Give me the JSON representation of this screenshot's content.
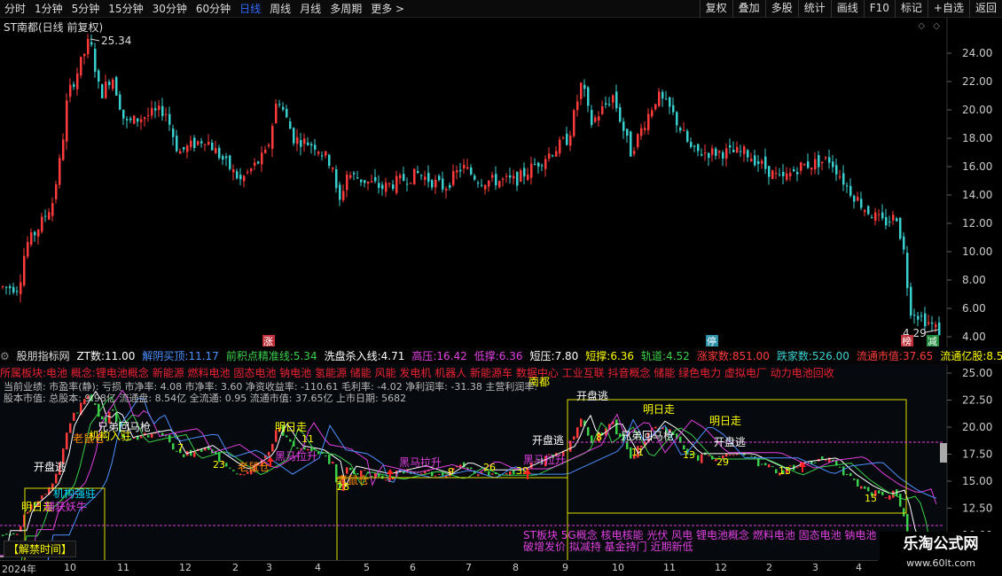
{
  "toolbar": {
    "periods": [
      "分时",
      "1分钟",
      "5分钟",
      "15分钟",
      "30分钟",
      "60分钟",
      "日线",
      "周线",
      "月线",
      "多周期",
      "更多 >"
    ],
    "active_period": "日线",
    "tools": [
      "复权",
      "叠加",
      "多股",
      "统计",
      "画线",
      "F10",
      "标记",
      "+自选",
      "返回"
    ]
  },
  "main": {
    "title": "ST南都(日线 前复权)",
    "high_label": "25.34",
    "low_label": "4.29",
    "icons": [
      "◇",
      "◇"
    ],
    "price_ticks": [
      "24.00",
      "22.00",
      "20.00",
      "18.00",
      "16.00",
      "14.00",
      "12.00",
      "10.00",
      "8.00",
      "6.00",
      "4.00"
    ],
    "badges": [
      "涨",
      "停",
      "榜",
      "减"
    ]
  },
  "indicator": {
    "name": "股朋指标网",
    "fields": [
      {
        "label": "ZT数:",
        "value": "11.00",
        "color": "#ffffff"
      },
      {
        "label": "解阴买顶:",
        "value": "11.17",
        "color": "#4a90ff"
      },
      {
        "label": "前积点精准线:",
        "value": "5.34",
        "color": "#3ad04a"
      },
      {
        "label": "洗盘杀入线:",
        "value": "4.71",
        "color": "#ffffff"
      },
      {
        "label": "高压:",
        "value": "16.42",
        "color": "#e040e0"
      },
      {
        "label": "低撑:",
        "value": "6.36",
        "color": "#e040e0"
      },
      {
        "label": "短压:",
        "value": "7.80",
        "color": "#ffffff"
      },
      {
        "label": "短撑:",
        "value": "6.36",
        "color": "#ffff00"
      },
      {
        "label": "轨道:",
        "value": "4.52",
        "color": "#3ad04a"
      },
      {
        "label": "涨家数:",
        "value": "851.00",
        "color": "#ff3b3b"
      },
      {
        "label": "跌家数:",
        "value": "526.00",
        "color": "#3ad0d0"
      },
      {
        "label": "流通市值:",
        "value": "37.65",
        "color": "#ff3b3b"
      },
      {
        "label": "流通亿股:",
        "value": "8.5",
        "color": "#ffff00"
      }
    ],
    "concepts_top": "所属板块:电池  概念:锂电池概念 新能源 燃料电池 固态电池 钠电池 氢能源 储能 风能 发电机 机器人 新能源车 数据中心 工业互联 抖音概念 储能 绿色电力 虚拟电厂 动力电池回收",
    "finance_line1": "当前业绩: 市盈率(静): 亏损 市净率: 4.08 市净率: 3.60 净资收益率: -110.61 毛利率: -4.02 净利润率: -31.38 主营利润率:",
    "finance_line2": "股本市值: 总股本: 9.98亿 流通盘: 8.54亿 全流通: 0.95 流通市值: 37.65亿 上市日期: 5682",
    "region": "南都",
    "right_ticks": [
      "25.00",
      "22.50",
      "20.00",
      "17.50",
      "15.00",
      "12.50",
      "10.00",
      "7.50"
    ],
    "concepts_bottom_1": "ST板块 5G概念 核电核能 光伏 风电 锂电池概念 燃料电池 固态电池 钠电池",
    "concepts_bottom_2": "破增发价 拟减持 基金持门 近期新低",
    "bottom_left": "【解禁时间】",
    "labels": [
      {
        "text": "明日走",
        "color": "#ffff00"
      },
      {
        "text": "开盘逃",
        "color": "#ffffff"
      },
      {
        "text": "老鼠仓",
        "color": "#ff8c00"
      },
      {
        "text": "兄弟回马枪",
        "color": "#ffffff"
      },
      {
        "text": "黑马拉升",
        "color": "#e040e0"
      },
      {
        "text": "捕获妖牛",
        "color": "#e040e0"
      },
      {
        "text": "机构入驻",
        "color": "#ffff00"
      },
      {
        "text": "机构强驻",
        "color": "#00e0ff"
      },
      {
        "text": "机构驻",
        "color": "#00e0ff"
      }
    ],
    "counts": [
      "7",
      "23",
      "11",
      "28",
      "9",
      "26",
      "39",
      "8",
      "11",
      "13",
      "29",
      "13",
      "15"
    ]
  },
  "date_axis": [
    "2024年",
    "10",
    "11",
    "12",
    "2",
    "3",
    "4",
    "5",
    "6",
    "7",
    "8",
    "9",
    "10",
    "11",
    "12",
    "2",
    "3",
    "4"
  ],
  "watermark": {
    "line1": "乐淘公式网",
    "line2": "www.60lt.com"
  },
  "colors": {
    "up": "#ff3b3b",
    "down": "#3ad0d0",
    "accent": "#2e6bff",
    "yellow": "#ffff00",
    "magenta": "#e040e0",
    "green": "#3ad04a"
  }
}
